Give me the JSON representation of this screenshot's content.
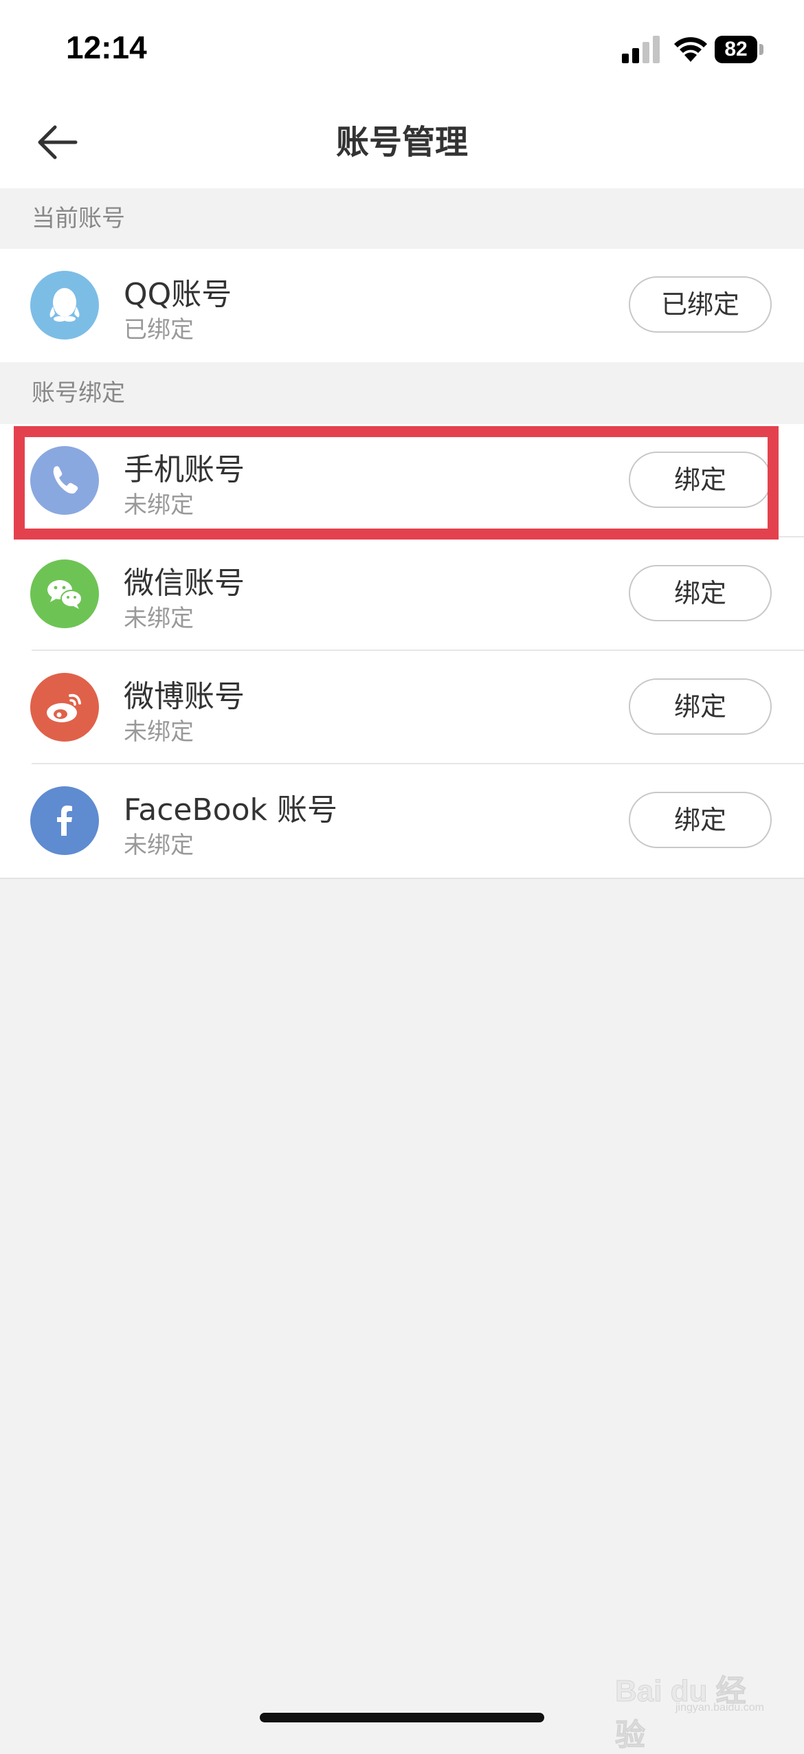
{
  "status_bar": {
    "time": "12:14",
    "battery": "82"
  },
  "nav": {
    "title": "账号管理"
  },
  "sections": {
    "current": "当前账号",
    "binding": "账号绑定"
  },
  "current_account": {
    "title": "QQ账号",
    "status": "已绑定",
    "button": "已绑定",
    "icon": "qq-icon",
    "color": "#7cbde6"
  },
  "bind_accounts": [
    {
      "title": "手机账号",
      "status": "未绑定",
      "button": "绑定",
      "icon": "phone-icon",
      "color": "#8aa8e0"
    },
    {
      "title": "微信账号",
      "status": "未绑定",
      "button": "绑定",
      "icon": "wechat-icon",
      "color": "#6dc454"
    },
    {
      "title": "微博账号",
      "status": "未绑定",
      "button": "绑定",
      "icon": "weibo-icon",
      "color": "#e0614a"
    },
    {
      "title": "FaceBook 账号",
      "status": "未绑定",
      "button": "绑定",
      "icon": "facebook-icon",
      "color": "#5f8bd1"
    }
  ],
  "watermark": {
    "main": "Bai du 经验",
    "sub": "jingyan.baidu.com"
  },
  "highlight_color": "#e4414f"
}
